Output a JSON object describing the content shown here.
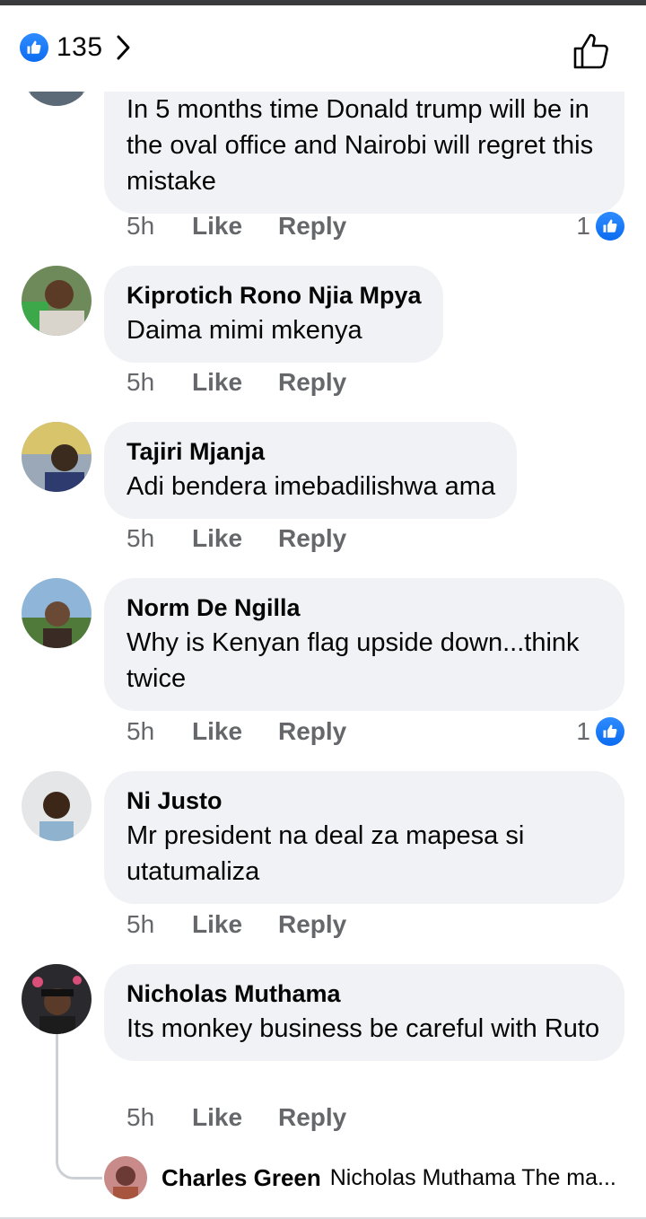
{
  "header": {
    "reaction_count": "135"
  },
  "comments": [
    {
      "text": "In 5 months time Donald trump will be in the oval office and Nairobi will regret this mistake",
      "time": "5h",
      "like_label": "Like",
      "reply_label": "Reply",
      "likes": "1"
    },
    {
      "author": "Kiprotich Rono Njia Mpya",
      "text": "Daima mimi mkenya",
      "time": "5h",
      "like_label": "Like",
      "reply_label": "Reply"
    },
    {
      "author": "Tajiri Mjanja",
      "text": "Adi bendera imebadilishwa ama",
      "time": "5h",
      "like_label": "Like",
      "reply_label": "Reply"
    },
    {
      "author": "Norm De Ngilla",
      "text": "Why is Kenyan flag upside down...think twice",
      "time": "5h",
      "like_label": "Like",
      "reply_label": "Reply",
      "likes": "1"
    },
    {
      "author": "Ni Justo",
      "text": "Mr president na deal za mapesa si utatumaliza",
      "time": "5h",
      "like_label": "Like",
      "reply_label": "Reply"
    },
    {
      "author": "Nicholas Muthama",
      "text": "Its monkey business be careful with Ruto",
      "time": "5h",
      "like_label": "Like",
      "reply_label": "Reply"
    }
  ],
  "reply_preview": {
    "author": "Charles Green",
    "snippet": "Nicholas Muthama The ma..."
  },
  "colors": {
    "accent": "#1877f2",
    "bubble": "#f0f2f5",
    "meta": "#65676b"
  }
}
